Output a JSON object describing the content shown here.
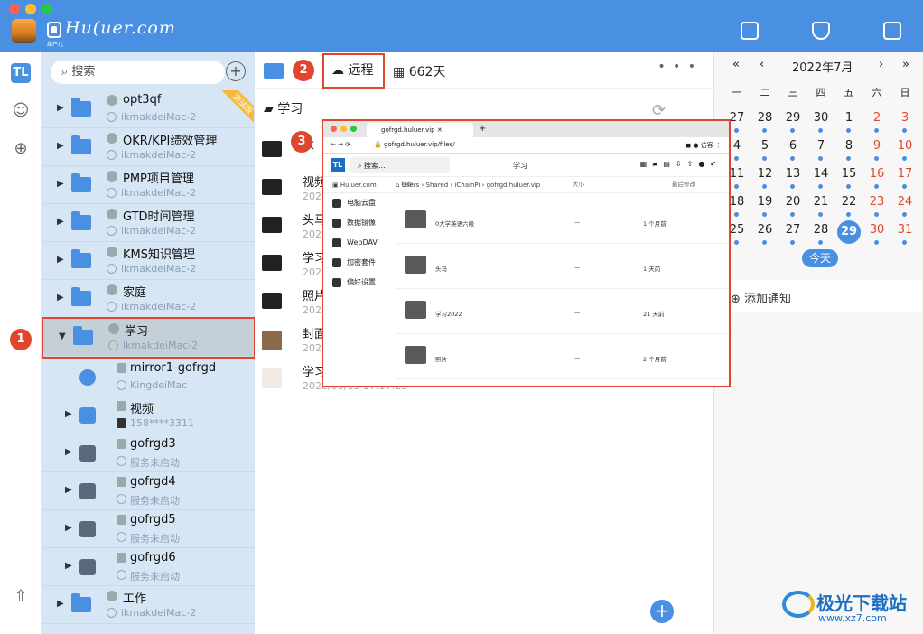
{
  "app": {
    "logo_text": "Hu(uer.com",
    "logo_sub": "葫芦儿"
  },
  "sidebar": {
    "search_placeholder": "搜索",
    "ribbon": "测试版",
    "items": [
      {
        "name": "opt3qf",
        "sub": "ikmakdeiMac-2"
      },
      {
        "name": "OKR/KPI绩效管理",
        "sub": "ikmakdeiMac-2"
      },
      {
        "name": "PMP项目管理",
        "sub": "ikmakdeiMac-2"
      },
      {
        "name": "GTD时间管理",
        "sub": "ikmakdeiMac-2"
      },
      {
        "name": "KMS知识管理",
        "sub": "ikmakdeiMac-2"
      },
      {
        "name": "家庭",
        "sub": "ikmakdeiMac-2"
      },
      {
        "name": "学习",
        "sub": "ikmakdeiMac-2"
      }
    ],
    "children": [
      {
        "name": "mirror1-gofrgd",
        "sub": "KingdeiMac"
      },
      {
        "name": "视频",
        "sub": "158****3311"
      },
      {
        "name": "gofrgd3",
        "sub": "服务未启动"
      },
      {
        "name": "gofrgd4",
        "sub": "服务未启动"
      },
      {
        "name": "gofrgd5",
        "sub": "服务未启动"
      },
      {
        "name": "gofrgd6",
        "sub": "服务未启动"
      }
    ],
    "last": {
      "name": "工作",
      "sub": "ikmakdeiMac-2"
    }
  },
  "main": {
    "remote_label": "远程",
    "days_label": "662天",
    "more": "• • •",
    "path": "学习",
    "files": [
      {
        "name": "大",
        "date": ""
      },
      {
        "name": "视频",
        "date": "202"
      },
      {
        "name": "头马",
        "date": "202"
      },
      {
        "name": "学习",
        "date": "202"
      },
      {
        "name": "照片",
        "date": "202"
      },
      {
        "name": "封面",
        "date": "202"
      },
      {
        "name": "学习",
        "date": "2022/05/15 17:17:25"
      }
    ]
  },
  "badges": {
    "b1": "1",
    "b2": "2",
    "b3": "3"
  },
  "browser": {
    "tab": "gofrgd.huluer.vip",
    "url": "gofrgd.huluer.vip/files/",
    "search": "搜索...",
    "title": "学习",
    "visitor": "访客",
    "crumb": [
      "Huluer.com",
      "Users",
      "Shared",
      "iChainPi",
      "gofrgd.huluer.vip"
    ],
    "nav": [
      "电脑云盘",
      "数据镜像",
      "WebDAV",
      "加密套件",
      "偏好设置"
    ],
    "cols": {
      "name": "名称",
      "size": "大小",
      "modified": "最后修改"
    },
    "rows": [
      {
        "name": "0大学英语六级",
        "size": "—",
        "mod": "1 个月前"
      },
      {
        "name": "头马",
        "size": "—",
        "mod": "1 天前"
      },
      {
        "name": "学习2022",
        "size": "—",
        "mod": "21 天前"
      },
      {
        "name": "照片",
        "size": "—",
        "mod": "2 个月前"
      }
    ]
  },
  "calendar": {
    "prev_year": "«",
    "prev_month": "‹",
    "title": "2022年7月",
    "next_month": "›",
    "next_year": "»",
    "weekdays": [
      "一",
      "二",
      "三",
      "四",
      "五",
      "六",
      "日"
    ],
    "weeks": [
      [
        "27",
        "28",
        "29",
        "30",
        "1",
        "2",
        "3"
      ],
      [
        "4",
        "5",
        "6",
        "7",
        "8",
        "9",
        "10"
      ],
      [
        "11",
        "12",
        "13",
        "14",
        "15",
        "16",
        "17"
      ],
      [
        "18",
        "19",
        "20",
        "21",
        "22",
        "23",
        "24"
      ],
      [
        "25",
        "26",
        "27",
        "28",
        "29",
        "30",
        "31"
      ]
    ],
    "today_day": "29",
    "today_label": "今天",
    "notice": "添加通知"
  },
  "watermark": {
    "big": "极光下载站",
    "small": "www.xz7.com"
  },
  "colors": {
    "accent": "#4a90e2",
    "highlight": "#e0462c"
  }
}
